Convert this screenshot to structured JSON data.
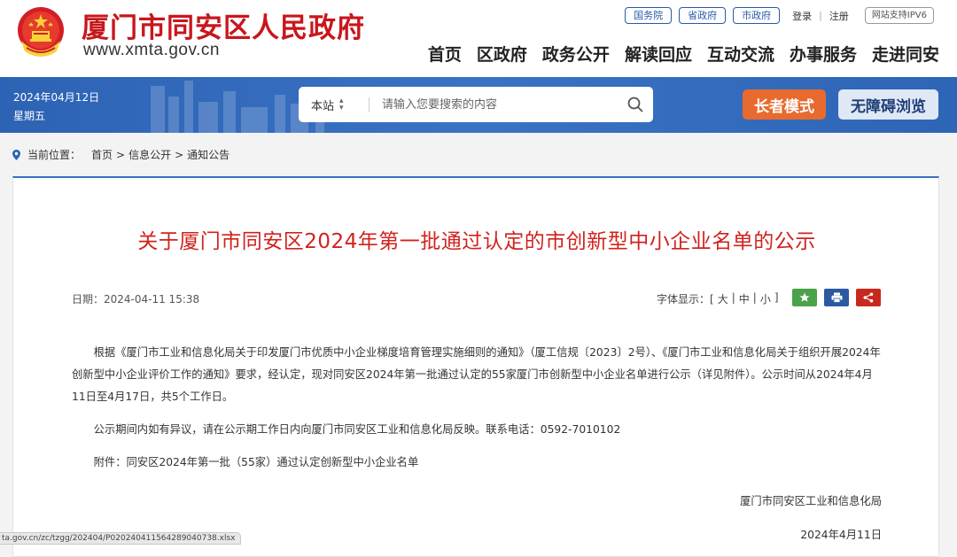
{
  "header": {
    "site_title": "厦门市同安区人民政府",
    "site_url": "www.xmta.gov.cn",
    "top_links": [
      "国务院",
      "省政府",
      "市政府"
    ],
    "login": "登录",
    "separator": "|",
    "register": "注册",
    "ipv6": "网站支持IPV6",
    "nav": [
      "首页",
      "区政府",
      "政务公开",
      "解读回应",
      "互动交流",
      "办事服务",
      "走进同安"
    ]
  },
  "bar": {
    "date": "2024年04月12日",
    "weekday": "星期五",
    "search_scope": "本站",
    "search_placeholder": "请输入您要搜索的内容",
    "elder_mode": "长者模式",
    "accessible": "无障碍浏览"
  },
  "breadcrumb": {
    "prefix": "当前位置：",
    "items": [
      "首页",
      "信息公开",
      "通知公告"
    ],
    "sep": ">"
  },
  "article": {
    "title": "关于厦门市同安区2024年第一批通过认定的市创新型中小企业名单的公示",
    "date": "日期：2024-04-11 15:38",
    "font_size_label": "字体显示：[",
    "font_sizes": [
      "大",
      "中",
      "小"
    ],
    "font_size_sep": "|",
    "font_size_close": "]",
    "paragraphs": [
      "根据《厦门市工业和信息化局关于印发厦门市优质中小企业梯度培育管理实施细则的通知》（厦工信规〔2023〕2号）、《厦门市工业和信息化局关于组织开展2024年创新型中小企业评价工作的通知》要求，经认定，现对同安区2024年第一批通过认定的55家厦门市创新型中小企业名单进行公示（详见附件）。公示时间从2024年4月11日至4月17日，共5个工作日。",
      "公示期间内如有异议，请在公示期工作日内向厦门市同安区工业和信息化局反映。联系电话：0592-7010102",
      "附件：同安区2024年第一批（55家）通过认定创新型中小企业名单"
    ],
    "signature_org": "厦门市同安区工业和信息化局",
    "signature_date": "2024年4月11日"
  },
  "status_url": "ta.gov.cn/zc/tzgg/202404/P020240411564289040738.xlsx",
  "colors": {
    "brand_red": "#c8161d",
    "title_red": "#d0231e",
    "bar_blue": "#3a72c4",
    "elder_orange": "#e86a2e"
  },
  "icons": [
    "national-emblem-icon",
    "search-icon",
    "location-pin-icon",
    "favorite-icon",
    "print-icon",
    "share-icon"
  ]
}
